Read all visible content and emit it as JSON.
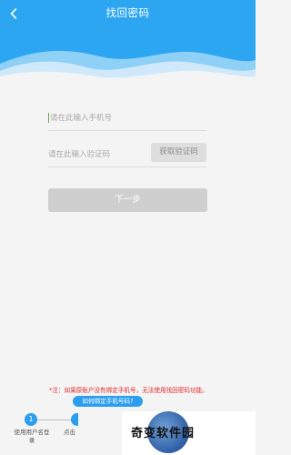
{
  "header": {
    "title": "找回密码",
    "back_icon": "chevron-left-icon",
    "background": "#2da6f2"
  },
  "form": {
    "phone_placeholder": "请在此输入手机号",
    "code_placeholder": "请在此输入验证码",
    "get_code_label": "获取验证码",
    "next_label": "下一步"
  },
  "notice": {
    "text": "*注：如果原账户没有绑定手机号，无法使用找回密码功能。",
    "link_label": "如何绑定手机号码?"
  },
  "steps": [
    {
      "number": "1",
      "label": "使用用户名登录"
    },
    {
      "number": "",
      "label": "点击"
    }
  ],
  "watermark": {
    "text": "奇变软件园"
  },
  "colors": {
    "accent": "#2b9ef0",
    "notice": "#e62b2b",
    "disabled_button": "#cfcfcf"
  }
}
